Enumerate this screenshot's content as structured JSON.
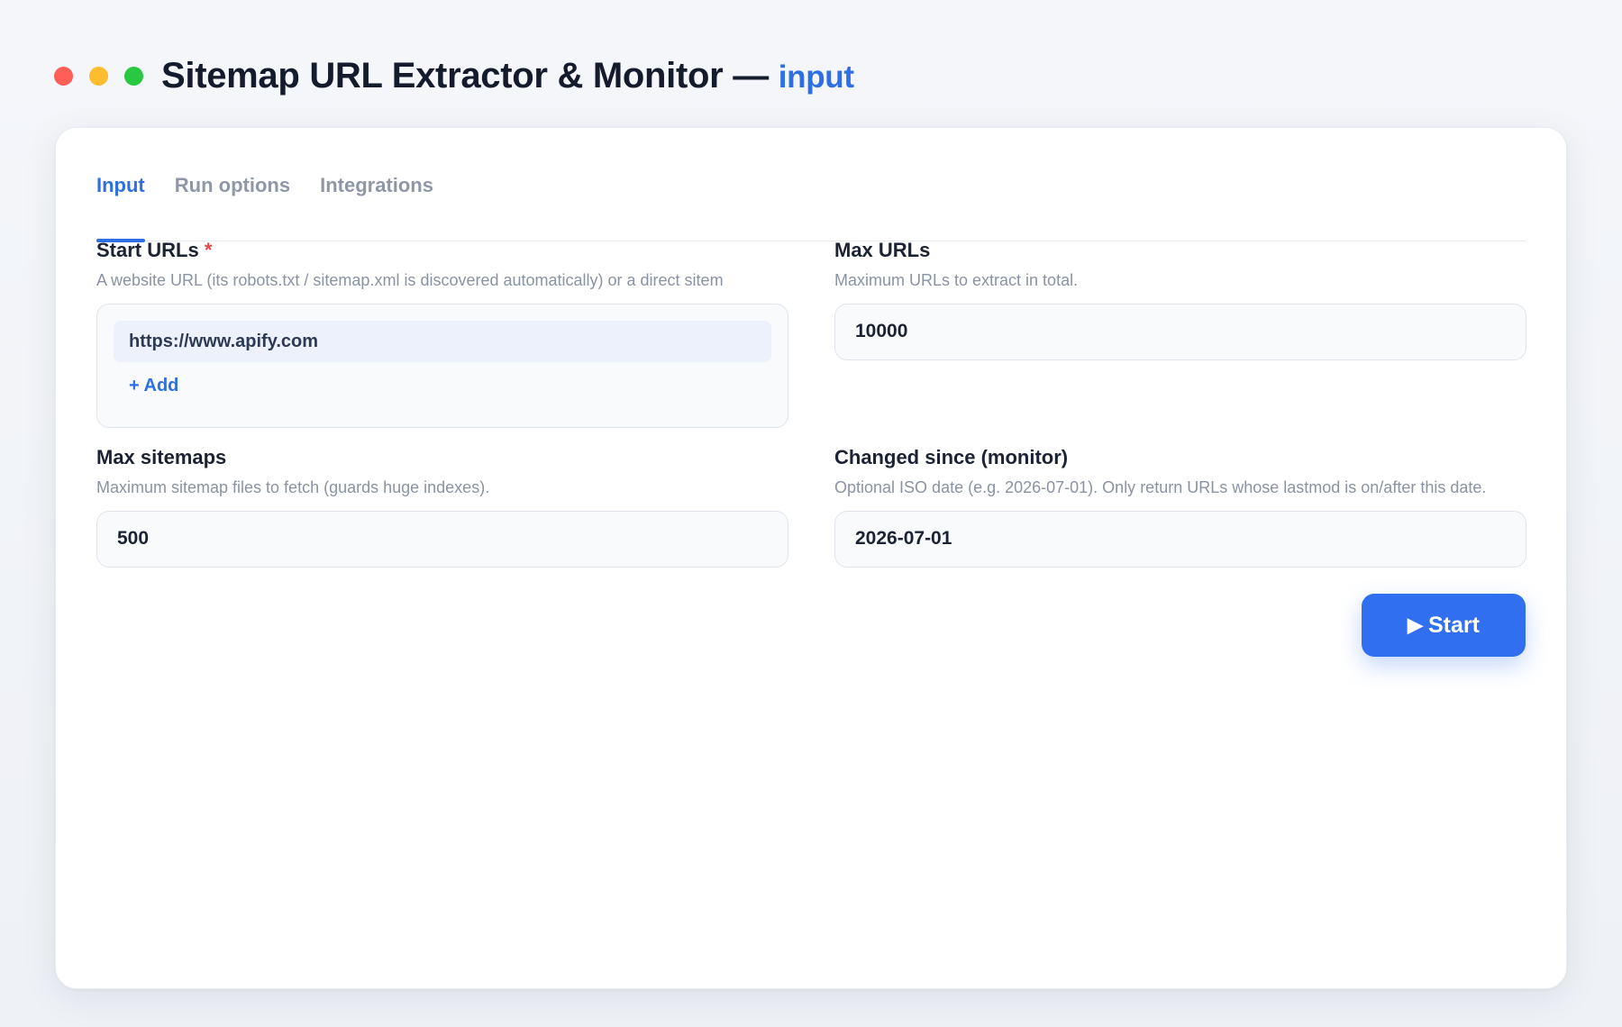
{
  "window": {
    "title": "Sitemap URL Extractor & Monitor —",
    "title_accent": "input"
  },
  "tabs": [
    {
      "label": "Input",
      "active": true
    },
    {
      "label": "Run options",
      "active": false
    },
    {
      "label": "Integrations",
      "active": false
    }
  ],
  "fields": {
    "start_urls": {
      "label": "Start URLs",
      "required_mark": "*",
      "help": "A website URL (its robots.txt / sitemap.xml is discovered automatically) or a direct sitem",
      "values": [
        "https://www.apify.com"
      ],
      "add_label": "+ Add"
    },
    "max_urls": {
      "label": "Max URLs",
      "help": "Maximum URLs to extract in total.",
      "value": "10000"
    },
    "max_sitemaps": {
      "label": "Max sitemaps",
      "help": "Maximum sitemap files to fetch (guards huge indexes).",
      "value": "500"
    },
    "changed_since": {
      "label": "Changed since (monitor)",
      "help": "Optional ISO date (e.g. 2026-07-01). Only return URLs whose lastmod is on/after this date.",
      "value": "2026-07-01"
    }
  },
  "actions": {
    "start_icon": "▶",
    "start_label": "Start"
  },
  "colors": {
    "accent": "#2f6fe4",
    "button": "#2f6ff0",
    "required": "#e5484d",
    "dot_red": "#ff5f57",
    "dot_yellow": "#febc2e",
    "dot_green": "#28c840"
  }
}
